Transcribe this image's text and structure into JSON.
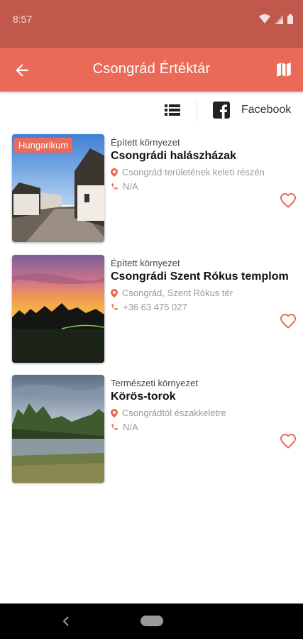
{
  "status": {
    "time": "8:57"
  },
  "header": {
    "title": "Csongrád Értéktár"
  },
  "toolbar": {
    "facebook_label": "Facebook"
  },
  "items": [
    {
      "badge": "Hungarikum",
      "category": "Épített környezet",
      "name": "Csongrádi halászházak",
      "location": "Csongrád területének keleti részén",
      "phone": "N/A"
    },
    {
      "badge": "",
      "category": "Épített környezet",
      "name": "Csongrádi Szent Rókus templom",
      "location": "Csongrád, Szent Rókus tér",
      "phone": "+36 63 475 027"
    },
    {
      "badge": "",
      "category": "Természeti környezet",
      "name": "Körös-torok",
      "location": "Csongrádtól északkeletre",
      "phone": "N/A"
    }
  ],
  "colors": {
    "accent": "#e86a57",
    "statusbar": "#c0584b"
  }
}
